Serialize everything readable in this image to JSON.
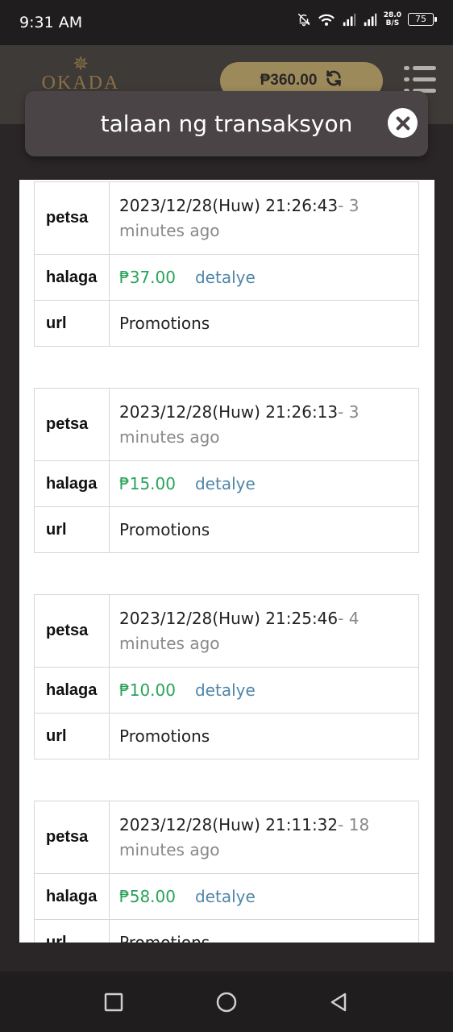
{
  "status_bar": {
    "time": "9:31 AM",
    "net_speed_value": "28.0",
    "net_speed_unit": "B/S",
    "battery": "75",
    "icons": [
      "notifications-off-icon",
      "wifi-icon",
      "signal-icon",
      "signal-icon"
    ]
  },
  "header": {
    "logo_text": "OKADA",
    "balance": "₱360.00",
    "icons": [
      "refresh-icon",
      "menu-icon"
    ]
  },
  "modal": {
    "title": "talaan ng transaksyon",
    "close_icon": "close-icon"
  },
  "labels": {
    "date": "petsa",
    "amount": "halaga",
    "url": "url",
    "detail": "detalye"
  },
  "records": [
    {
      "date": "2023/12/28(Huw) 21:26:43",
      "ago": "- 3 minutes ago",
      "amount": "₱37.00",
      "url": "Promotions"
    },
    {
      "date": "2023/12/28(Huw) 21:26:13",
      "ago": "- 3 minutes ago",
      "amount": "₱15.00",
      "url": "Promotions"
    },
    {
      "date": "2023/12/28(Huw) 21:25:46",
      "ago": "- 4 minutes ago",
      "amount": "₱10.00",
      "url": "Promotions"
    },
    {
      "date": "2023/12/28(Huw) 21:11:32",
      "ago": "- 18 minutes ago",
      "amount": "₱58.00",
      "url": "Promotions"
    }
  ],
  "colors": {
    "amount_green": "#2aa35a",
    "link_blue": "#4f86a8",
    "pill_gold": "#9c8a5a"
  },
  "nav_icons": [
    "recents-icon",
    "home-icon",
    "back-icon"
  ]
}
